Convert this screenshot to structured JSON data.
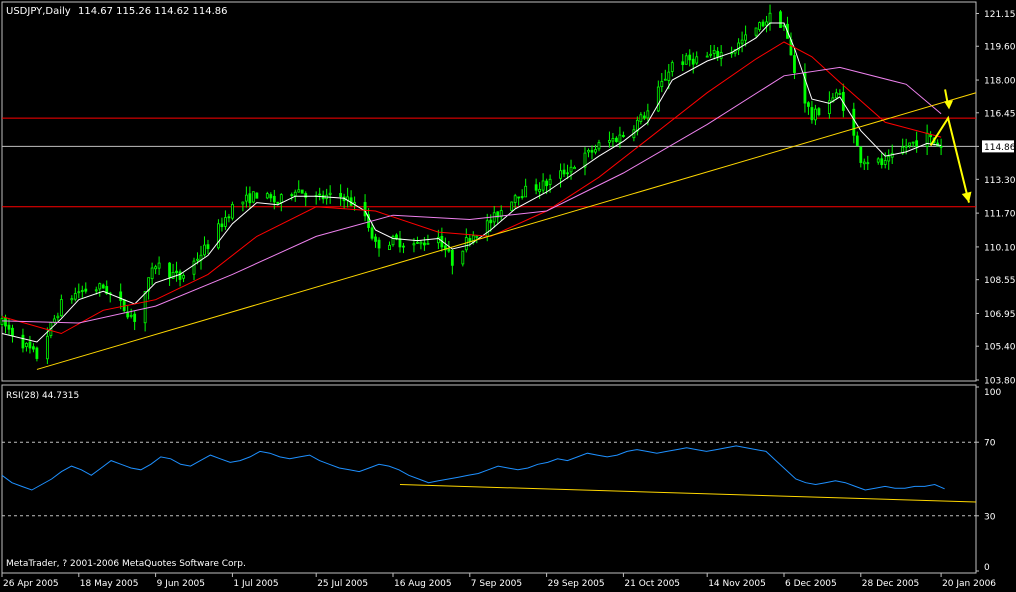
{
  "header": {
    "symbol_label": "USDJPY,Daily",
    "ohlc": "114.67 115.26 114.62 114.86"
  },
  "rsi_header": "RSI(28) 44.7315",
  "copyright": "MetaTrader, ? 2001-2006 MetaQuotes Software Corp.",
  "colors": {
    "background": "#000000",
    "frame": "#c0c0c0",
    "candle": "#00ff00",
    "ma_fast": "#ffffff",
    "ma_mid": "#ff0000",
    "ma_slow": "#ee82ee",
    "trendline": "#ffd700",
    "hline": "#ff0000",
    "rsi_line": "#1e90ff",
    "arrow": "#ffff00",
    "price_box": "#ff0000",
    "text": "#ffffff"
  },
  "chart_data": [
    {
      "type": "candlestick",
      "panel": "price",
      "ylim": [
        103.8,
        121.6
      ],
      "y_ticks": [
        "121.15",
        "119.60",
        "118.00",
        "116.45",
        "114.86",
        "113.30",
        "111.70",
        "110.10",
        "108.55",
        "106.95",
        "105.40",
        "103.80"
      ],
      "x_labels": [
        "26 Apr 2005",
        "18 May 2005",
        "9 Jun 2005",
        "1 Jul 2005",
        "25 Jul 2005",
        "16 Aug 2005",
        "7 Sep 2005",
        "29 Sep 2005",
        "21 Oct 2005",
        "14 Nov 2005",
        "6 Dec 2005",
        "28 Dec 2005",
        "20 Jan 2006"
      ],
      "x_range": [
        "2005-04-26",
        "2006-01-30"
      ],
      "close_path": [
        [
          "2005-04-26",
          106.5
        ],
        [
          "2005-05-06",
          104.9
        ],
        [
          "2005-05-13",
          107.4
        ],
        [
          "2005-05-18",
          108.0
        ],
        [
          "2005-05-25",
          108.2
        ],
        [
          "2005-06-03",
          106.7
        ],
        [
          "2005-06-09",
          109.3
        ],
        [
          "2005-06-16",
          108.6
        ],
        [
          "2005-06-24",
          110.2
        ],
        [
          "2005-07-01",
          112.0
        ],
        [
          "2005-07-08",
          112.6
        ],
        [
          "2005-07-14",
          112.2
        ],
        [
          "2005-07-19",
          112.9
        ],
        [
          "2005-07-25",
          112.4
        ],
        [
          "2005-08-02",
          112.5
        ],
        [
          "2005-08-08",
          111.6
        ],
        [
          "2005-08-11",
          110.2
        ],
        [
          "2005-08-16",
          110.4
        ],
        [
          "2005-08-23",
          110.2
        ],
        [
          "2005-08-29",
          110.6
        ],
        [
          "2005-09-02",
          109.4
        ],
        [
          "2005-09-07",
          110.6
        ],
        [
          "2005-09-13",
          111.3
        ],
        [
          "2005-09-20",
          112.6
        ],
        [
          "2005-09-29",
          113.1
        ],
        [
          "2005-10-07",
          114.0
        ],
        [
          "2005-10-14",
          114.9
        ],
        [
          "2005-10-21",
          115.4
        ],
        [
          "2005-10-28",
          116.5
        ],
        [
          "2005-11-04",
          118.8
        ],
        [
          "2005-11-14",
          119.1
        ],
        [
          "2005-11-21",
          119.4
        ],
        [
          "2005-11-28",
          120.4
        ],
        [
          "2005-12-02",
          121.0
        ],
        [
          "2005-12-06",
          120.6
        ],
        [
          "2005-12-09",
          118.4
        ],
        [
          "2005-12-14",
          116.2
        ],
        [
          "2005-12-19",
          117.1
        ],
        [
          "2005-12-22",
          117.3
        ],
        [
          "2005-12-28",
          114.3
        ],
        [
          "2006-01-04",
          114.0
        ],
        [
          "2006-01-10",
          114.9
        ],
        [
          "2006-01-16",
          115.3
        ],
        [
          "2006-01-20",
          114.86
        ]
      ],
      "moving_averages": [
        {
          "style": "ma_fast",
          "values": [
            [
              "2005-04-26",
              106.0
            ],
            [
              "2005-05-06",
              105.6
            ],
            [
              "2005-05-13",
              106.7
            ],
            [
              "2005-05-18",
              107.6
            ],
            [
              "2005-05-25",
              108.0
            ],
            [
              "2005-06-03",
              107.4
            ],
            [
              "2005-06-09",
              108.4
            ],
            [
              "2005-06-16",
              108.8
            ],
            [
              "2005-06-24",
              109.7
            ],
            [
              "2005-07-01",
              111.2
            ],
            [
              "2005-07-08",
              112.2
            ],
            [
              "2005-07-14",
              112.1
            ],
            [
              "2005-07-19",
              112.5
            ],
            [
              "2005-07-25",
              112.5
            ],
            [
              "2005-08-02",
              112.4
            ],
            [
              "2005-08-08",
              111.8
            ],
            [
              "2005-08-11",
              110.9
            ],
            [
              "2005-08-16",
              110.5
            ],
            [
              "2005-08-23",
              110.4
            ],
            [
              "2005-08-29",
              110.5
            ],
            [
              "2005-09-02",
              110.0
            ],
            [
              "2005-09-07",
              110.2
            ],
            [
              "2005-09-13",
              110.9
            ],
            [
              "2005-09-20",
              111.9
            ],
            [
              "2005-09-29",
              112.7
            ],
            [
              "2005-10-07",
              113.6
            ],
            [
              "2005-10-14",
              114.4
            ],
            [
              "2005-10-21",
              115.1
            ],
            [
              "2005-10-28",
              116.0
            ],
            [
              "2005-11-04",
              118.0
            ],
            [
              "2005-11-14",
              118.9
            ],
            [
              "2005-11-21",
              119.3
            ],
            [
              "2005-11-28",
              120.0
            ],
            [
              "2005-12-02",
              120.7
            ],
            [
              "2005-12-06",
              120.7
            ],
            [
              "2005-12-09",
              119.5
            ],
            [
              "2005-12-14",
              117.1
            ],
            [
              "2005-12-19",
              116.9
            ],
            [
              "2005-12-22",
              117.2
            ],
            [
              "2005-12-28",
              115.6
            ],
            [
              "2006-01-04",
              114.4
            ],
            [
              "2006-01-10",
              114.6
            ],
            [
              "2006-01-16",
              115.0
            ],
            [
              "2006-01-20",
              114.9
            ]
          ]
        },
        {
          "style": "ma_mid",
          "values": [
            [
              "2005-04-26",
              106.8
            ],
            [
              "2005-05-13",
              106.0
            ],
            [
              "2005-05-25",
              107.1
            ],
            [
              "2005-06-09",
              107.6
            ],
            [
              "2005-06-24",
              108.8
            ],
            [
              "2005-07-08",
              110.6
            ],
            [
              "2005-07-25",
              112.0
            ],
            [
              "2005-08-11",
              111.8
            ],
            [
              "2005-08-29",
              110.8
            ],
            [
              "2005-09-13",
              110.6
            ],
            [
              "2005-09-29",
              111.8
            ],
            [
              "2005-10-14",
              113.4
            ],
            [
              "2005-10-28",
              115.2
            ],
            [
              "2005-11-14",
              117.4
            ],
            [
              "2005-11-28",
              119.0
            ],
            [
              "2005-12-06",
              119.8
            ],
            [
              "2005-12-14",
              119.1
            ],
            [
              "2005-12-22",
              117.9
            ],
            [
              "2006-01-04",
              116.0
            ],
            [
              "2006-01-20",
              115.3
            ]
          ]
        },
        {
          "style": "ma_slow",
          "values": [
            [
              "2005-04-26",
              106.6
            ],
            [
              "2005-05-18",
              106.5
            ],
            [
              "2005-06-09",
              107.3
            ],
            [
              "2005-07-01",
              108.8
            ],
            [
              "2005-07-25",
              110.6
            ],
            [
              "2005-08-16",
              111.6
            ],
            [
              "2005-09-07",
              111.4
            ],
            [
              "2005-09-29",
              111.8
            ],
            [
              "2005-10-21",
              113.6
            ],
            [
              "2005-11-14",
              115.9
            ],
            [
              "2005-12-06",
              118.2
            ],
            [
              "2005-12-22",
              118.6
            ],
            [
              "2006-01-10",
              117.8
            ],
            [
              "2006-01-20",
              116.4
            ]
          ]
        }
      ],
      "trendline": [
        [
          "2005-05-06",
          104.3
        ],
        [
          "2006-01-30",
          117.4
        ]
      ],
      "horizontal_lines": [
        {
          "value": 116.2,
          "label": "116.20",
          "color": "#ff0000"
        },
        {
          "value": 114.86,
          "label": "",
          "color": "#c0c0c0"
        },
        {
          "value": 112.0,
          "label": "112.00",
          "color": "#ff0000"
        }
      ],
      "current_price_label": "114.86",
      "annotations": [
        {
          "kind": "arrow-down",
          "at": [
            "2006-01-22",
            116.8
          ]
        },
        {
          "kind": "path-arrow",
          "points": [
            [
              "2006-01-17",
              114.9
            ],
            [
              "2006-01-22",
              116.2
            ],
            [
              "2006-01-28",
              112.2
            ]
          ]
        }
      ]
    },
    {
      "type": "line",
      "panel": "rsi",
      "ylim": [
        0,
        100
      ],
      "y_ticks": [
        "100",
        "70",
        "30",
        "0"
      ],
      "levels": [
        70,
        30
      ],
      "series_x_range": [
        "2005-04-26",
        "2006-01-21"
      ],
      "values": [
        52,
        48,
        46,
        44,
        47,
        50,
        54,
        57,
        55,
        52,
        56,
        60,
        58,
        56,
        55,
        58,
        62,
        61,
        58,
        57,
        60,
        63,
        61,
        59,
        60,
        62,
        65,
        64,
        62,
        61,
        62,
        63,
        60,
        58,
        56,
        55,
        54,
        56,
        58,
        57,
        55,
        52,
        50,
        48,
        49,
        50,
        51,
        52,
        53,
        55,
        57,
        56,
        55,
        56,
        58,
        59,
        61,
        60,
        62,
        64,
        63,
        62,
        63,
        65,
        66,
        65,
        64,
        65,
        66,
        67,
        66,
        65,
        66,
        67,
        68,
        67,
        66,
        65,
        60,
        55,
        50,
        48,
        47,
        48,
        49,
        48,
        46,
        44,
        45,
        46,
        45,
        45,
        46,
        46,
        47,
        44.7
      ],
      "trendline": [
        [
          "2005-08-18",
          47.0
        ],
        [
          "2006-01-30",
          37.5
        ]
      ]
    }
  ]
}
